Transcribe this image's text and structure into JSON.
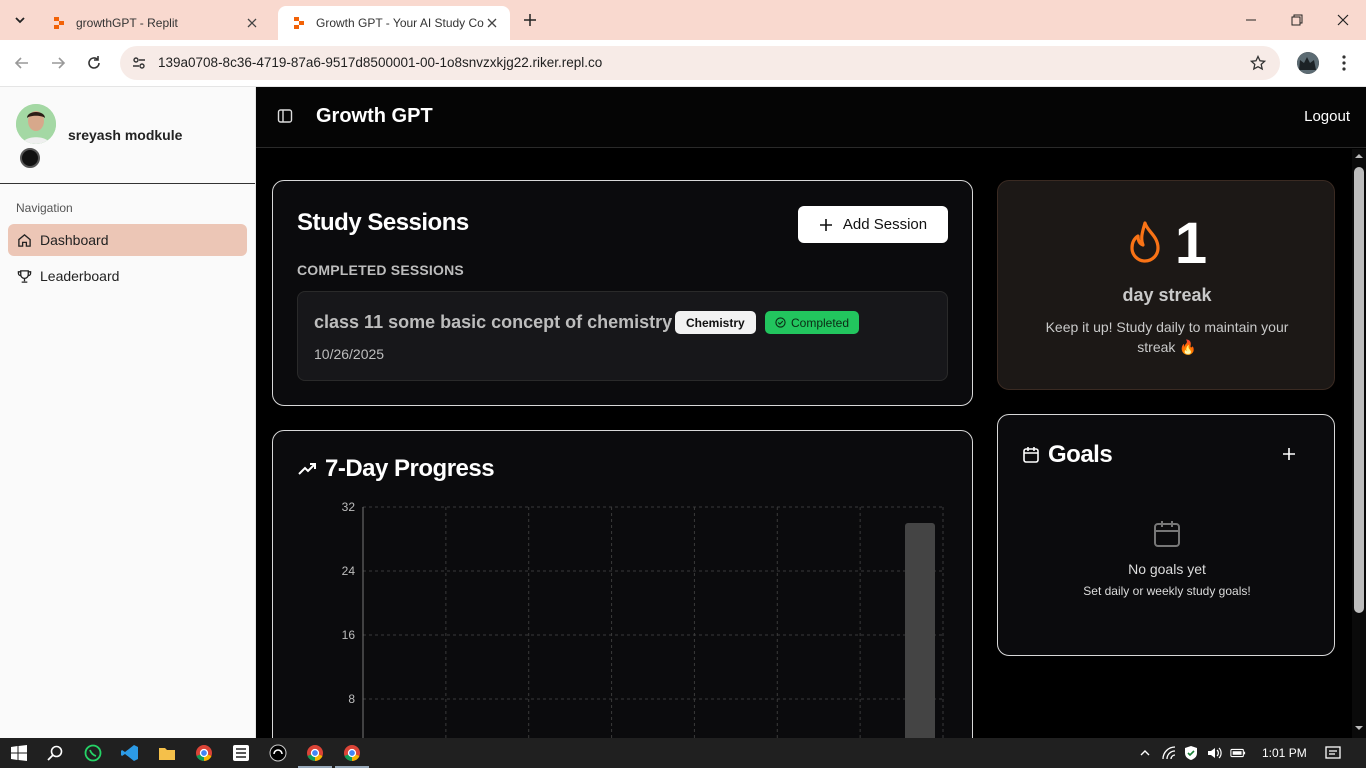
{
  "browser": {
    "tabs": [
      {
        "title": "growthGPT - Replit",
        "active": false
      },
      {
        "title": "Growth GPT - Your AI Study Co",
        "active": true
      }
    ],
    "url": "139a0708-8c36-4719-87a6-9517d8500001-00-1o8snvzxkjg22.riker.repl.co"
  },
  "sidebar": {
    "user_name": "sreyash modkule",
    "group_label": "Navigation",
    "items": [
      {
        "label": "Dashboard",
        "icon": "home-icon",
        "active": true
      },
      {
        "label": "Leaderboard",
        "icon": "trophy-icon",
        "active": false
      }
    ]
  },
  "header": {
    "title": "Growth GPT",
    "logout_label": "Logout"
  },
  "sessions": {
    "title": "Study Sessions",
    "add_label": "Add Session",
    "section_label": "COMPLETED SESSIONS",
    "items": [
      {
        "title": "class 11 some basic concept of chemistry",
        "subject": "Chemistry",
        "status": "Completed",
        "date": "10/26/2025"
      }
    ]
  },
  "progress": {
    "title": "7-Day Progress"
  },
  "chart_data": {
    "type": "bar",
    "title": "7-Day Progress",
    "categories": [
      "",
      "",
      "",
      "",
      "",
      "",
      ""
    ],
    "values": [
      0,
      0,
      0,
      0,
      0,
      1,
      30
    ],
    "ylim": [
      0,
      32
    ],
    "yticks": [
      8,
      16,
      24,
      32
    ],
    "grid": true
  },
  "streak": {
    "count": "1",
    "label": "day streak",
    "message": "Keep it up! Study daily to maintain your streak 🔥"
  },
  "goals": {
    "title": "Goals",
    "empty_title": "No goals yet",
    "empty_subtitle": "Set daily or weekly study goals!"
  },
  "taskbar": {
    "time": "1:01 PM"
  },
  "colors": {
    "tab_strip": "#f9d9cf",
    "accent_active_nav": "#ecc6b6",
    "completed_green": "#22c55e",
    "flame_orange": "#f97316"
  }
}
